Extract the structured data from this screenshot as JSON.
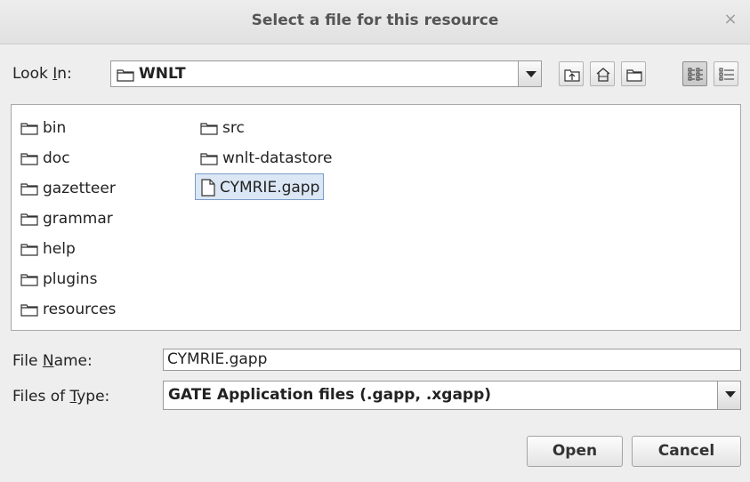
{
  "window": {
    "title": "Select a file for this resource",
    "close_glyph": "×"
  },
  "look_in": {
    "label_pre": "Look ",
    "label_mn": "I",
    "label_post": "n:",
    "value": "WNLT",
    "icon": "folder-icon"
  },
  "toolbar": {
    "buttons": [
      {
        "name": "up-one-level-button",
        "icon": "folder-up-icon"
      },
      {
        "name": "home-button",
        "icon": "home-icon"
      },
      {
        "name": "new-folder-button",
        "icon": "new-folder-icon"
      },
      {
        "name": "list-view-button",
        "icon": "list-view-icon",
        "active": true
      },
      {
        "name": "details-view-button",
        "icon": "details-view-icon"
      }
    ]
  },
  "files": [
    {
      "name": "bin",
      "type": "folder"
    },
    {
      "name": "doc",
      "type": "folder"
    },
    {
      "name": "gazetteer",
      "type": "folder"
    },
    {
      "name": "grammar",
      "type": "folder"
    },
    {
      "name": "help",
      "type": "folder"
    },
    {
      "name": "plugins",
      "type": "folder"
    },
    {
      "name": "resources",
      "type": "folder"
    },
    {
      "name": "src",
      "type": "folder"
    },
    {
      "name": "wnlt-datastore",
      "type": "folder"
    },
    {
      "name": "CYMRIE.gapp",
      "type": "file",
      "selected": true
    }
  ],
  "file_name": {
    "label_pre": "File ",
    "label_mn": "N",
    "label_post": "ame:",
    "value": "CYMRIE.gapp"
  },
  "file_type": {
    "label_pre": "Files of ",
    "label_mn": "T",
    "label_post": "ype:",
    "value": "GATE Application files (.gapp, .xgapp)"
  },
  "buttons": {
    "open": "Open",
    "cancel": "Cancel"
  },
  "colors": {
    "selection_bg": "#dbe7f5",
    "selection_border": "#7a9cc8",
    "dialog_bg": "#eeeeee"
  }
}
